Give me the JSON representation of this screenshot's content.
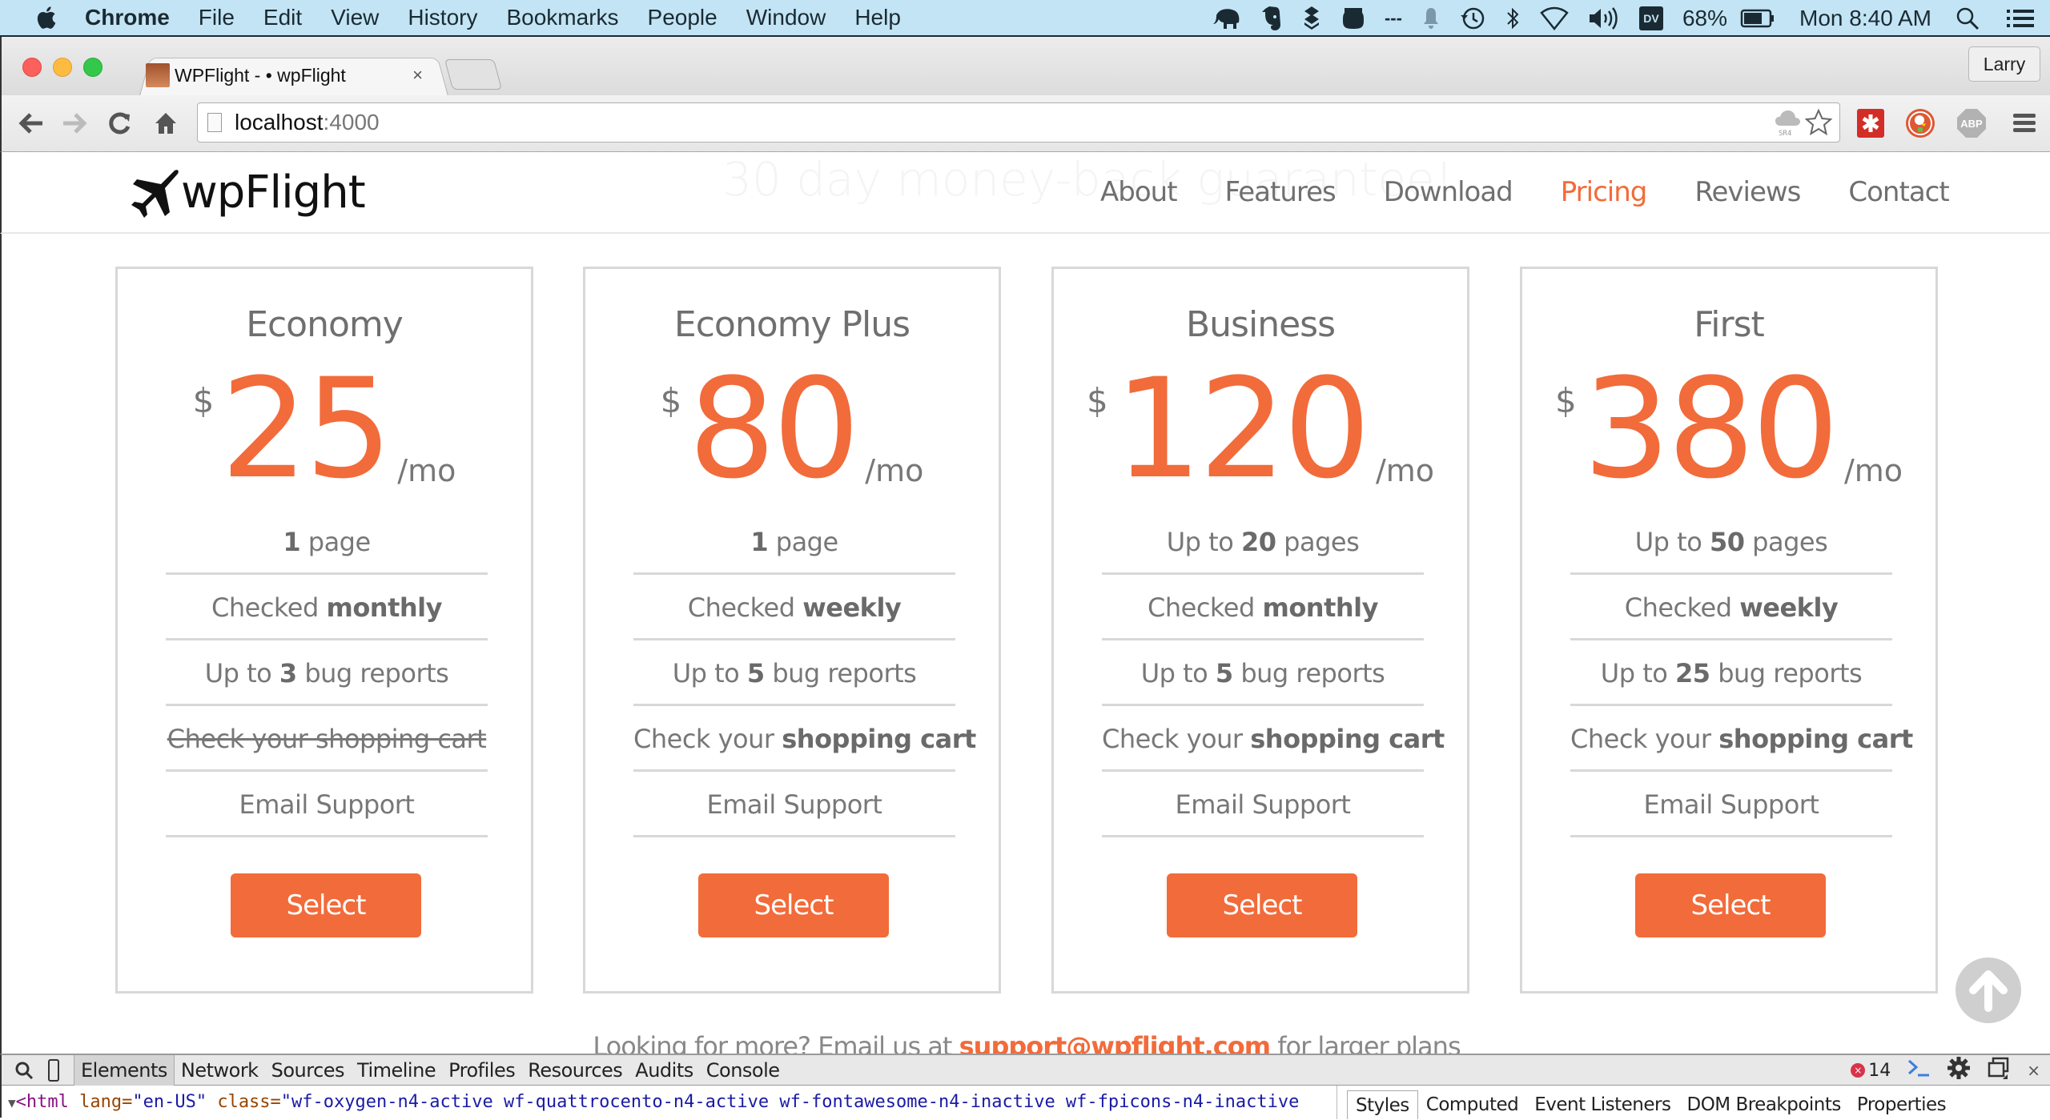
{
  "menubar": {
    "app_name": "Chrome",
    "items": [
      "File",
      "Edit",
      "View",
      "History",
      "Bookmarks",
      "People",
      "Window",
      "Help"
    ],
    "status": {
      "dashes": "---",
      "dv_badge": "DV",
      "battery": "68%",
      "clock": "Mon 8:40 AM"
    },
    "icons": [
      "apple-icon",
      "elephant-icon",
      "evernote-icon",
      "dropbox-icon",
      "jar-icon",
      "notification-bell-icon",
      "time-machine-icon",
      "bluetooth-icon",
      "wifi-icon",
      "volume-icon",
      "battery-icon",
      "spotlight-search-icon",
      "notification-center-icon"
    ]
  },
  "browser": {
    "tab": {
      "title": "WPFlight - • wpFlight",
      "close": "×"
    },
    "profile_name": "Larry",
    "url_host": "localhost",
    "url_port": ":4000",
    "extensions": [
      "sr4-cloud-icon",
      "bookmark-star-icon",
      "lastpass-icon",
      "duckduckgo-icon",
      "adblock-plus-icon",
      "chrome-menu-icon"
    ],
    "abp_label": "ABP"
  },
  "site": {
    "logo_text": "wpFlight",
    "guarantee_text": "30 day money-back guarantee!",
    "nav": [
      {
        "label": "About",
        "active": false
      },
      {
        "label": "Features",
        "active": false
      },
      {
        "label": "Download",
        "active": false
      },
      {
        "label": "Pricing",
        "active": true
      },
      {
        "label": "Reviews",
        "active": false
      },
      {
        "label": "Contact",
        "active": false
      }
    ],
    "accent_color": "#f26b3a"
  },
  "plans": [
    {
      "name": "Economy",
      "currency": "$",
      "amount": "25",
      "period": "/mo",
      "features": [
        {
          "pre": "",
          "bold": "1",
          "post": " page",
          "struck": false
        },
        {
          "pre": "Checked ",
          "bold": "monthly",
          "post": "",
          "struck": false
        },
        {
          "pre": "Up to ",
          "bold": "3",
          "post": " bug reports",
          "struck": false
        },
        {
          "pre": "Check your shopping cart",
          "bold": "",
          "post": "",
          "struck": true
        },
        {
          "pre": "Email Support",
          "bold": "",
          "post": "",
          "struck": false
        }
      ],
      "button": "Select"
    },
    {
      "name": "Economy Plus",
      "currency": "$",
      "amount": "80",
      "period": "/mo",
      "features": [
        {
          "pre": "",
          "bold": "1",
          "post": " page",
          "struck": false
        },
        {
          "pre": "Checked ",
          "bold": "weekly",
          "post": "",
          "struck": false
        },
        {
          "pre": "Up to ",
          "bold": "5",
          "post": " bug reports",
          "struck": false
        },
        {
          "pre": "Check your ",
          "bold": "shopping cart",
          "post": "",
          "struck": false
        },
        {
          "pre": "Email Support",
          "bold": "",
          "post": "",
          "struck": false
        }
      ],
      "button": "Select"
    },
    {
      "name": "Business",
      "currency": "$",
      "amount": "120",
      "period": "/mo",
      "features": [
        {
          "pre": "Up to ",
          "bold": "20",
          "post": " pages",
          "struck": false
        },
        {
          "pre": "Checked ",
          "bold": "monthly",
          "post": "",
          "struck": false
        },
        {
          "pre": "Up to ",
          "bold": "5",
          "post": " bug reports",
          "struck": false
        },
        {
          "pre": "Check your ",
          "bold": "shopping cart",
          "post": "",
          "struck": false
        },
        {
          "pre": "Email Support",
          "bold": "",
          "post": "",
          "struck": false
        }
      ],
      "button": "Select"
    },
    {
      "name": "First",
      "currency": "$",
      "amount": "380",
      "period": "/mo",
      "features": [
        {
          "pre": "Up to ",
          "bold": "50",
          "post": " pages",
          "struck": false
        },
        {
          "pre": "Checked ",
          "bold": "weekly",
          "post": "",
          "struck": false
        },
        {
          "pre": "Up to ",
          "bold": "25",
          "post": " bug reports",
          "struck": false
        },
        {
          "pre": "Check your ",
          "bold": "shopping cart",
          "post": "",
          "struck": false
        },
        {
          "pre": "Email Support",
          "bold": "",
          "post": "",
          "struck": false
        }
      ],
      "button": "Select"
    }
  ],
  "footer_note": {
    "pre": "Looking for more? Email us at ",
    "email": "support@wpflight.com",
    "post": " for larger plans"
  },
  "devtools": {
    "tabs": [
      "Elements",
      "Network",
      "Sources",
      "Timeline",
      "Profiles",
      "Resources",
      "Audits",
      "Console"
    ],
    "active_tab": "Elements",
    "error_count": "14",
    "dom_line": {
      "tag_open": "<html",
      "lang_attr": " lang=",
      "lang_val": "\"en-US\"",
      "class_attr": " class=",
      "class_val": "\"wf-oxygen-n4-active wf-quattrocento-n4-active wf-fontawesome-n4-inactive wf-fpicons-n4-inactive"
    },
    "side_tabs": [
      "Styles",
      "Computed",
      "Event Listeners",
      "DOM Breakpoints",
      "Properties"
    ],
    "active_side_tab": "Styles"
  }
}
